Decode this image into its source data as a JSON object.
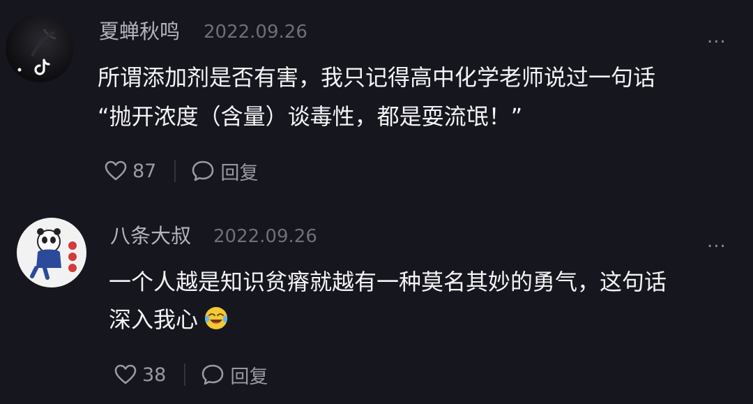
{
  "comments": [
    {
      "username": "夏蝉秋鸣",
      "date": "2022.09.26",
      "more": "...",
      "lines": [
        "所谓添加剂是否有害，我只记得高中化学老师说过一句话",
        "“抛开浓度（含量）谈毒性，都是耍流氓！”"
      ],
      "likes": "87",
      "reply_label": "回复",
      "avatar_icon": "tiktok-logo-icon"
    },
    {
      "username": "八条大叔",
      "date": "2022.09.26",
      "more": "...",
      "lines": [
        "一个人越是知识贫瘠就越有一种莫名其妙的勇气，这句话",
        "深入我心"
      ],
      "emoji": "laughing-crying-emoji",
      "likes": "38",
      "reply_label": "回复",
      "avatar_icon": "panda-avatar-icon"
    }
  ],
  "colors": {
    "background": "#16161e",
    "username": "#b4b4bc",
    "date": "#6f6f78",
    "body_text": "#f4f4f6",
    "action": "#9a9aa4"
  }
}
